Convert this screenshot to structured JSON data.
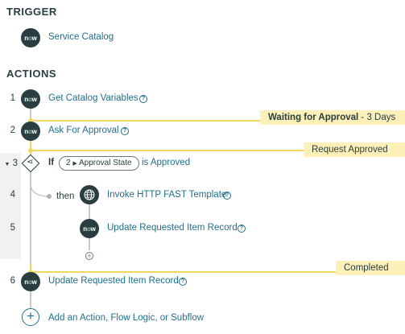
{
  "trigger": {
    "title": "TRIGGER",
    "icon_text_pre": "n",
    "icon_text_o": "o",
    "icon_text_post": "w",
    "label": "Service Catalog"
  },
  "actions": {
    "title": "ACTIONS",
    "items": [
      {
        "num": "1",
        "label": "Get Catalog Variables"
      },
      {
        "num": "2",
        "label": "Ask For Approval"
      },
      {
        "num": "3",
        "if_label": "If",
        "pill_num": "2",
        "pill_label": "Approval State",
        "condition": "is Approved"
      },
      {
        "num": "4",
        "then_label": "then",
        "label": "Invoke HTTP FAST Template"
      },
      {
        "num": "5",
        "label": "Update Requested Item Record"
      },
      {
        "num": "6",
        "label": "Update Requested Item Record"
      }
    ],
    "add_label": "Add an Action, Flow Logic, or Subflow"
  },
  "banners": {
    "waiting_bold": "Waiting for Approval",
    "waiting_rest": " - 3 Days",
    "approved": "Request Approved",
    "completed": "Completed"
  },
  "colors": {
    "accent": "#1f6f8b",
    "icon_bg": "#293e40",
    "state_line": "#f6d663",
    "banner_bg": "#fdf0b8"
  }
}
